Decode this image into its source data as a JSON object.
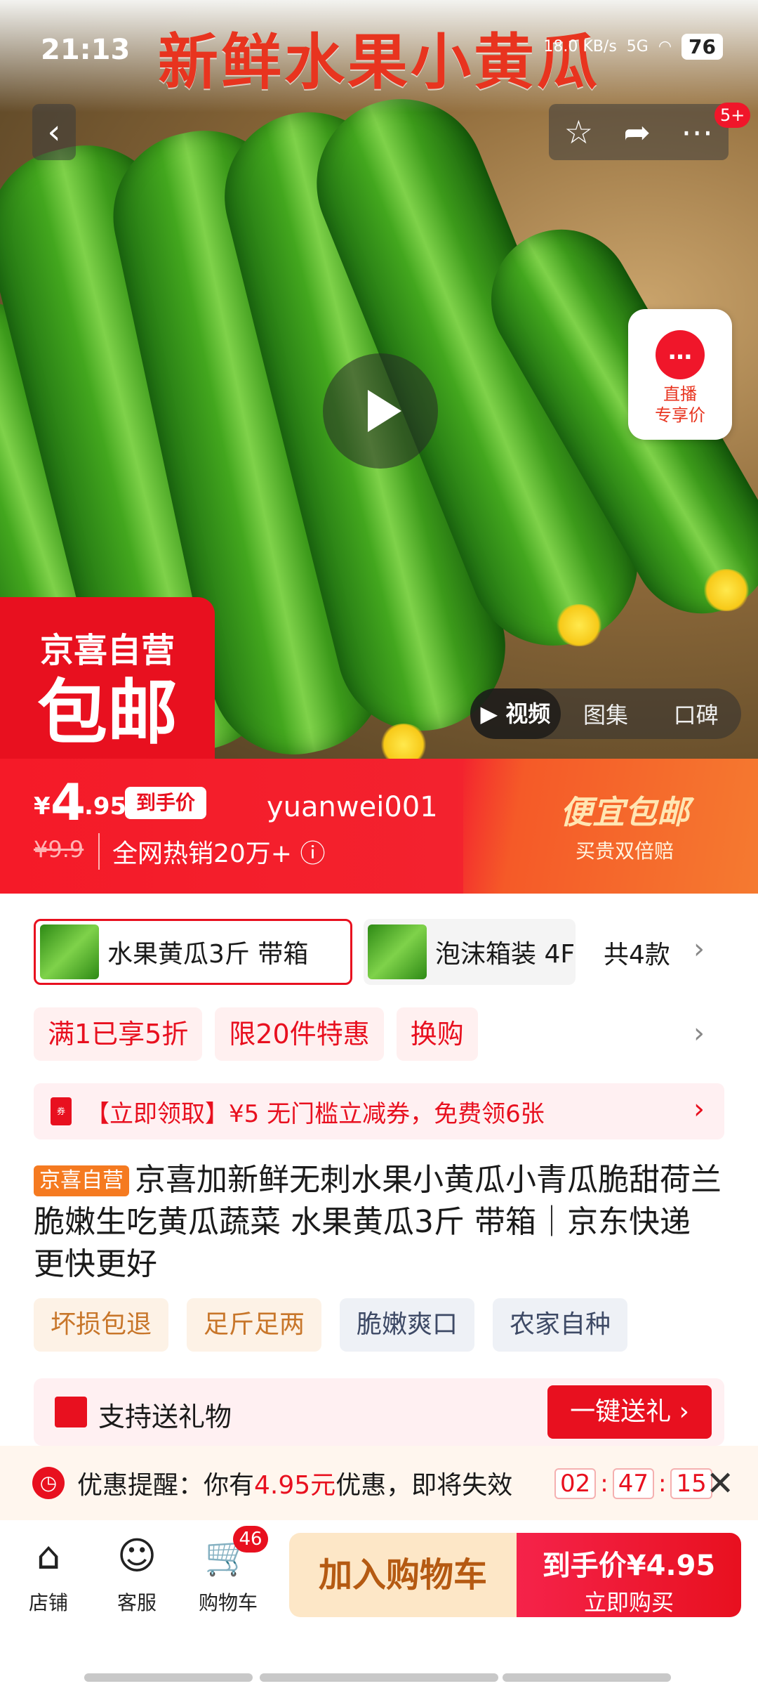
{
  "status_bar": {
    "time": "21:13",
    "network": "18.0 KB/s",
    "signal": "5G",
    "battery": "76"
  },
  "hero": {
    "banner_title": "新鲜水果小黄瓜",
    "more_badge": "5+",
    "live_label_1": "直播",
    "live_label_2": "专享价",
    "self_op_line1": "京喜自营",
    "self_op_line2": "包邮",
    "media_tabs": [
      "视频",
      "图集",
      "口碑"
    ]
  },
  "price_banner": {
    "currency": "¥",
    "price_int": "4",
    "price_dec": ".95",
    "price_tag": "到手价",
    "username": "yuanwei001",
    "orig_price": "¥9.9",
    "sales": "全网热销20万+",
    "deal_title": "便宜包邮",
    "deal_sub": "买贵双倍赔"
  },
  "variants": {
    "items": [
      "水果黄瓜3斤 带箱",
      "泡沫箱装 4F"
    ],
    "count_label": "共4款"
  },
  "promos": [
    "满1已享5折",
    "限20件特惠",
    "换购"
  ],
  "coupon": {
    "text": "【立即领取】¥5 无门槛立减券，免费领6张"
  },
  "product": {
    "self_tag": "京喜自营",
    "title": "京喜加新鲜无刺水果小黄瓜小青瓜脆甜荷兰脆嫩生吃黄瓜蔬菜 水果黄瓜3斤 带箱｜京东快递 更快更好"
  },
  "tags": [
    "坏损包退",
    "足斤足两",
    "脆嫩爽口",
    "农家自种"
  ],
  "gift": {
    "label": "支持送礼物",
    "button": "一键送礼 ›"
  },
  "reminder": {
    "prefix": "优惠提醒：你有",
    "amount": "4.95元",
    "suffix": "优惠，即将失效",
    "countdown": [
      "02",
      "47",
      "15"
    ]
  },
  "bottom_bar": {
    "shop": "店铺",
    "service": "客服",
    "cart": "购物车",
    "cart_count": "46",
    "add_cart": "加入购物车",
    "buy_top": "到手价¥4.95",
    "buy_bottom": "立即购买"
  }
}
